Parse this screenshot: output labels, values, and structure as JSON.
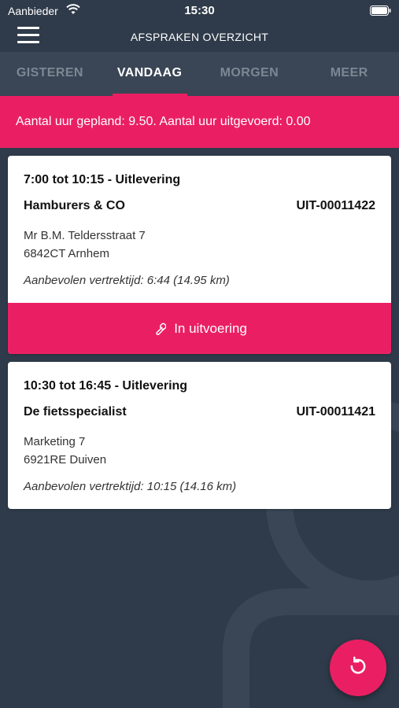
{
  "status_bar": {
    "carrier": "Aanbieder",
    "time": "15:30"
  },
  "header": {
    "title": "AFSPRAKEN OVERZICHT",
    "menu_icon": "hamburger-menu-icon"
  },
  "tabs": [
    {
      "label": "GISTEREN",
      "active": false
    },
    {
      "label": "VANDAAG",
      "active": true
    },
    {
      "label": "MORGEN",
      "active": false
    },
    {
      "label": "MEER",
      "active": false
    }
  ],
  "summary": {
    "text": "Aantal uur gepland: 9.50. Aantal uur uitgevoerd: 0.00"
  },
  "appointments": [
    {
      "time_slot": "7:00 tot 10:15 - Uitlevering",
      "customer": "Hamburers & CO",
      "order_number": "UIT-00011422",
      "address_line1": "Mr B.M. Teldersstraat 7",
      "address_line2": "6842CT Arnhem",
      "advice": "Aanbevolen vertrektijd: 6:44 (14.95 km)",
      "action_label": "In uitvoering",
      "action_icon": "wrench-icon"
    },
    {
      "time_slot": "10:30 tot 16:45 - Uitlevering",
      "customer": "De fietsspecialist",
      "order_number": "UIT-00011421",
      "address_line1": "Marketing 7",
      "address_line2": "6921RE Duiven",
      "advice": "Aanbevolen vertrektijd: 10:15 (14.16 km)"
    }
  ],
  "fab": {
    "icon": "refresh-icon"
  },
  "colors": {
    "background": "#2f3b4a",
    "tabbar": "#3a4655",
    "accent": "#ea1f63"
  }
}
